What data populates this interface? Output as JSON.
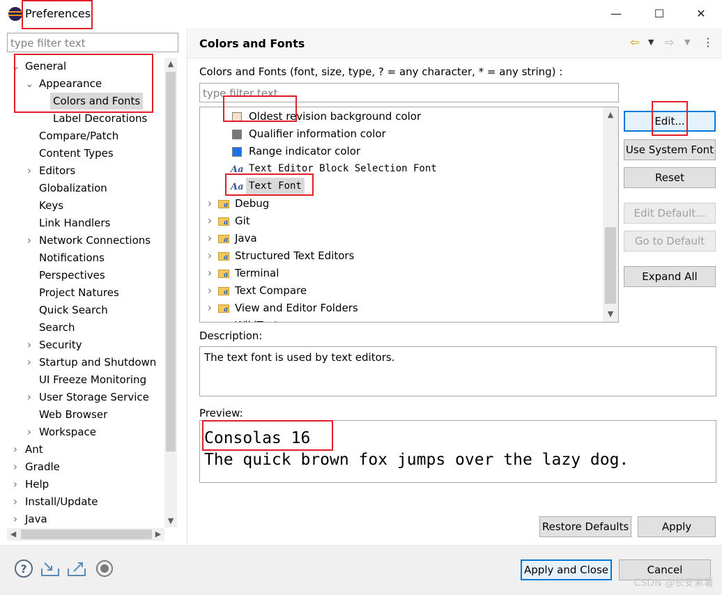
{
  "window": {
    "title": "Preferences",
    "minimize": "—",
    "maximize": "☐",
    "close": "✕"
  },
  "left": {
    "filter_placeholder": "type filter text",
    "tree": [
      {
        "label": "General",
        "indent": 0,
        "caret": "v"
      },
      {
        "label": "Appearance",
        "indent": 1,
        "caret": "v"
      },
      {
        "label": "Colors and Fonts",
        "indent": 2,
        "caret": "",
        "selected": true
      },
      {
        "label": "Label Decorations",
        "indent": 2,
        "caret": ""
      },
      {
        "label": "Compare/Patch",
        "indent": 1,
        "caret": ""
      },
      {
        "label": "Content Types",
        "indent": 1,
        "caret": ""
      },
      {
        "label": "Editors",
        "indent": 1,
        "caret": ">"
      },
      {
        "label": "Globalization",
        "indent": 1,
        "caret": ""
      },
      {
        "label": "Keys",
        "indent": 1,
        "caret": ""
      },
      {
        "label": "Link Handlers",
        "indent": 1,
        "caret": ""
      },
      {
        "label": "Network Connections",
        "indent": 1,
        "caret": ">"
      },
      {
        "label": "Notifications",
        "indent": 1,
        "caret": ""
      },
      {
        "label": "Perspectives",
        "indent": 1,
        "caret": ""
      },
      {
        "label": "Project Natures",
        "indent": 1,
        "caret": ""
      },
      {
        "label": "Quick Search",
        "indent": 1,
        "caret": ""
      },
      {
        "label": "Search",
        "indent": 1,
        "caret": ""
      },
      {
        "label": "Security",
        "indent": 1,
        "caret": ">"
      },
      {
        "label": "Startup and Shutdown",
        "indent": 1,
        "caret": ">"
      },
      {
        "label": "UI Freeze Monitoring",
        "indent": 1,
        "caret": ""
      },
      {
        "label": "User Storage Service",
        "indent": 1,
        "caret": ">"
      },
      {
        "label": "Web Browser",
        "indent": 1,
        "caret": ""
      },
      {
        "label": "Workspace",
        "indent": 1,
        "caret": ">"
      },
      {
        "label": "Ant",
        "indent": 0,
        "caret": ">"
      },
      {
        "label": "Gradle",
        "indent": 0,
        "caret": ">"
      },
      {
        "label": "Help",
        "indent": 0,
        "caret": ">"
      },
      {
        "label": "Install/Update",
        "indent": 0,
        "caret": ">"
      },
      {
        "label": "Java",
        "indent": 0,
        "caret": ">"
      }
    ]
  },
  "page": {
    "title": "Colors and Fonts",
    "intro": "Colors and Fonts (font, size, type, ? = any character, * = any string) :",
    "filter_placeholder": "type filter text",
    "items": [
      {
        "kind": "color",
        "label": "Oldest revision background color",
        "color": "#f5e1c9"
      },
      {
        "kind": "color",
        "label": "Qualifier information color",
        "color": "#777777"
      },
      {
        "kind": "color",
        "label": "Range indicator color",
        "color": "#1a73e8"
      },
      {
        "kind": "font",
        "label": "Text Editor Block Selection Font"
      },
      {
        "kind": "font",
        "label": "Text Font",
        "selected": true
      },
      {
        "kind": "category",
        "label": "Debug"
      },
      {
        "kind": "category",
        "label": "Git"
      },
      {
        "kind": "category",
        "label": "Java"
      },
      {
        "kind": "category",
        "label": "Structured Text Editors"
      },
      {
        "kind": "category",
        "label": "Terminal"
      },
      {
        "kind": "category",
        "label": "Text Compare"
      },
      {
        "kind": "category",
        "label": "View and Editor Folders"
      },
      {
        "kind": "category",
        "label": "WikiText"
      }
    ],
    "font_icon_text": "Aa",
    "buttons": {
      "edit": "Edit...",
      "use_system_font": "Use System Font",
      "reset": "Reset",
      "edit_default": "Edit Default...",
      "go_to_default": "Go to Default",
      "expand_all": "Expand All"
    },
    "description_label": "Description:",
    "description": "The text font is used by text editors.",
    "preview_label": "Preview:",
    "preview_line1": "Consolas 16",
    "preview_line2": "The quick brown fox jumps over the lazy dog.",
    "restore_defaults": "Restore Defaults",
    "apply": "Apply"
  },
  "footer": {
    "apply_and_close": "Apply and Close",
    "cancel": "Cancel",
    "icons": [
      "help-icon",
      "import-icon",
      "export-icon",
      "record-icon"
    ]
  },
  "watermark": "CSDN @长安紫薯"
}
